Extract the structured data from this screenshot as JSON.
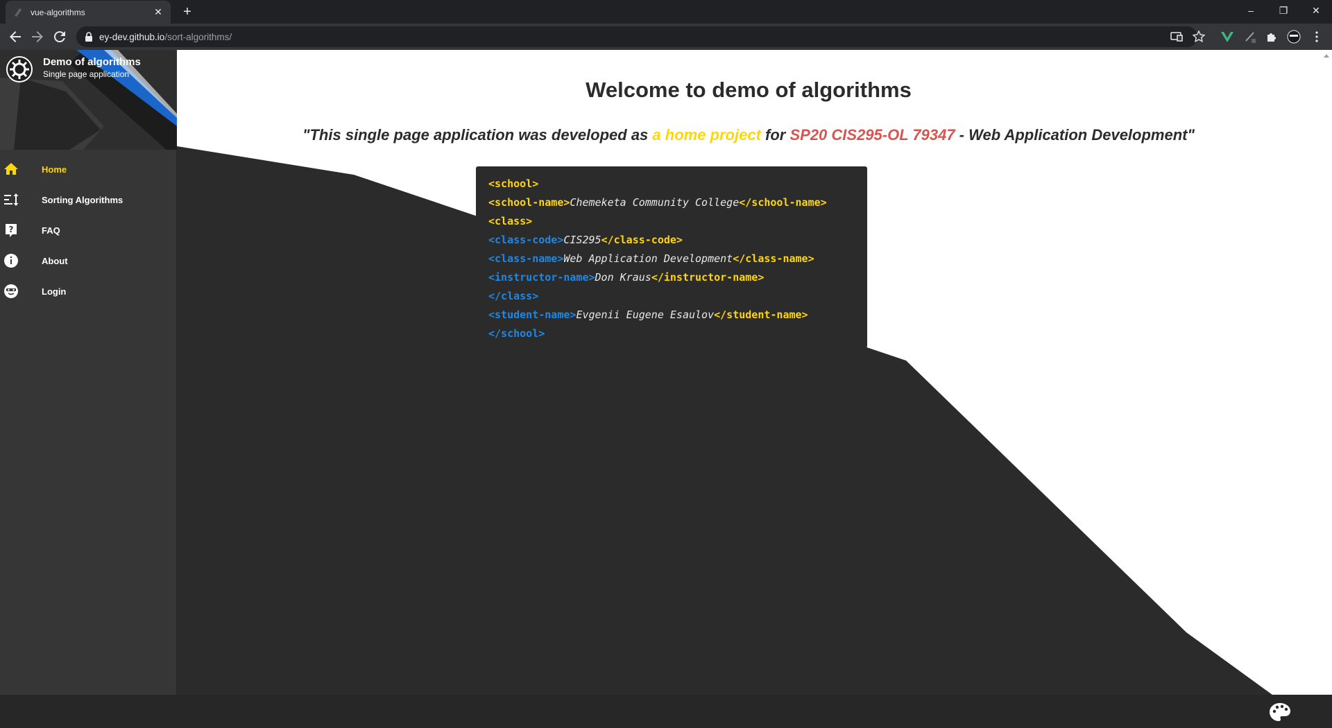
{
  "browser": {
    "tab_title": "vue-algorithms",
    "tab_close": "✕",
    "new_tab": "+",
    "url_host": "ey-dev.github.io",
    "url_path": "/sort-algorithms/",
    "window_minimize": "–",
    "window_restore": "❐",
    "window_close": "✕"
  },
  "drawer": {
    "title": "Demo of algorithms",
    "subtitle": "Single page application",
    "items": [
      {
        "label": "Home",
        "icon": "home-icon",
        "active": true
      },
      {
        "label": "Sorting Algorithms",
        "icon": "sort-icon",
        "active": false
      },
      {
        "label": "FAQ",
        "icon": "help-icon",
        "active": false
      },
      {
        "label": "About",
        "icon": "info-icon",
        "active": false
      },
      {
        "label": "Login",
        "icon": "face-icon",
        "active": false
      }
    ]
  },
  "main": {
    "heading": "Welcome to demo of algorithms",
    "quote": {
      "part1": "\"This single page application was developed as ",
      "highlight1": "a home project",
      "part2": " for ",
      "highlight2": "SP20 CIS295-OL 79347",
      "part3": " - Web Application Development\""
    },
    "code": {
      "school_open": "<school>",
      "school_name_open": "<school-name>",
      "school_name": "Chemeketa Community College",
      "school_name_close": "</school-name>",
      "class_open": "<class>",
      "class_code_open": "<class-code>",
      "class_code": "CIS295",
      "class_code_close": "</class-code>",
      "class_name_open": "<class-name>",
      "class_name": "Web Application Development",
      "class_name_close": "</class-name>",
      "instructor_open": "<instructor-name>",
      "instructor": "Don Kraus",
      "instructor_close": "</instructor-name>",
      "class_close": "</class>",
      "student_open": "<student-name>",
      "student": "Evgenii Eugene Esaulov",
      "student_close": "</student-name>",
      "school_close": "</school>"
    }
  },
  "colors": {
    "accent_yellow": "#ffd60a",
    "accent_red": "#d9534f",
    "accent_blue": "#1e88e5",
    "drawer_bg": "#363636",
    "code_bg": "#2b2b2b"
  }
}
